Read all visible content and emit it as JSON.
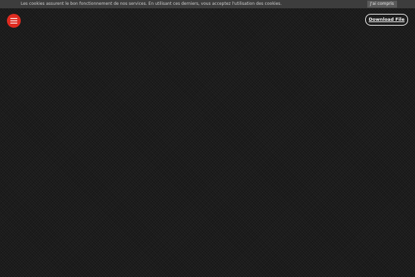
{
  "cookie_bar": {
    "message": "Les cookies assurent le bon fonctionnement de nos services. En utilisant ces derniers, vous acceptez l'utilisation des cookies.",
    "accept_label": "J'ai compris"
  },
  "header": {
    "menu_icon": "hamburger-menu-icon",
    "download_label": "Download File"
  },
  "colors": {
    "background": "#1c1c1c",
    "cookie_bar": "#3d3d3d",
    "menu_accent": "#e02b20",
    "download_border": "#ffffff"
  }
}
